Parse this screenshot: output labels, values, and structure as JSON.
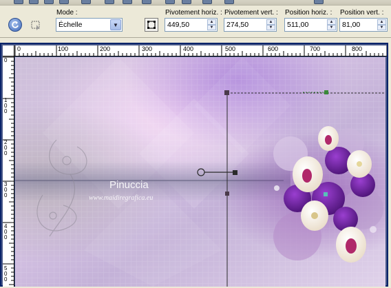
{
  "options": {
    "mode_label": "Mode :",
    "mode_value": "Échelle",
    "pivot_h_label": "Pivotement horiz. :",
    "pivot_h_value": "449,50",
    "pivot_v_label": "Pivotement vert. :",
    "pivot_v_value": "274,50",
    "pos_h_label": "Position horiz. :",
    "pos_h_value": "511,00",
    "pos_v_label": "Position vert. :",
    "pos_v_value": "81,00"
  },
  "ruler": {
    "h_labels": [
      "0",
      "100",
      "200",
      "300",
      "400",
      "500",
      "600",
      "700",
      "800"
    ],
    "v_labels": [
      "0",
      "100",
      "200",
      "300",
      "400",
      "500"
    ]
  },
  "canvas": {
    "watermark_title": "Pinuccia",
    "watermark_url": "www.maidiregrafica.eu"
  },
  "colors": {
    "selection_border": "#0a246a",
    "accent_purple": "#8a5cc2"
  }
}
